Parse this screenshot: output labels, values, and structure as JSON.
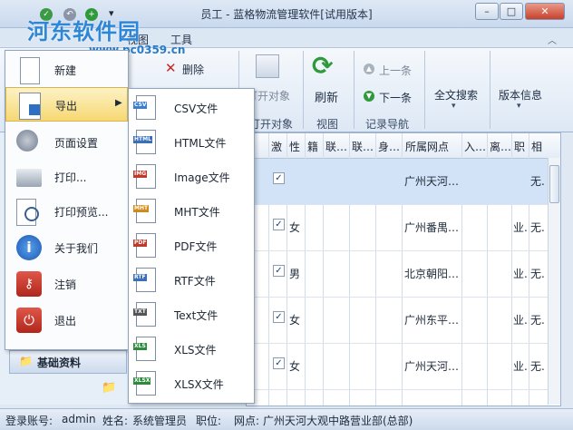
{
  "window": {
    "title": "员工 - 蓝格物流管理软件[试用版本]",
    "minimize": "–",
    "maximize": "□",
    "close": "✕"
  },
  "watermark": {
    "text": "河东软件园",
    "url": "www.pc0359.cn"
  },
  "ribbon": {
    "tabs": [
      "视图",
      "工具"
    ],
    "delete_label": "删除",
    "open_object_label": "打开对象",
    "open_object_group": "打开对象",
    "refresh_label": "刷新",
    "view_group": "视图",
    "prev_label": "上一条",
    "next_label": "下一条",
    "nav_group": "记录导航",
    "fulltext_label": "全文搜索",
    "version_label": "版本信息"
  },
  "grid": {
    "columns": [
      "激",
      "性",
      "籍",
      "联…",
      "联…",
      "身…",
      "所属网点",
      "入…",
      "离…",
      "职",
      "相"
    ],
    "rows": [
      {
        "active": true,
        "gender": "",
        "branch": "广州天河…",
        "job": "",
        "rel": "无."
      },
      {
        "active": true,
        "gender": "女",
        "branch": "广州番禺…",
        "job": "业.",
        "rel": "无."
      },
      {
        "active": true,
        "gender": "男",
        "branch": "北京朝阳…",
        "job": "业.",
        "rel": "无."
      },
      {
        "active": true,
        "gender": "女",
        "branch": "广州东平…",
        "job": "业.",
        "rel": "无."
      },
      {
        "active": true,
        "gender": "女",
        "branch": "广州天河…",
        "job": "业.",
        "rel": "无."
      }
    ]
  },
  "nav": {
    "header": "基础资料"
  },
  "app_menu": {
    "items": [
      {
        "label": "新建",
        "icon": "new-doc-icon"
      },
      {
        "label": "导出",
        "icon": "export-icon"
      },
      {
        "label": "页面设置",
        "icon": "page-setup-icon"
      },
      {
        "label": "打印...",
        "icon": "printer-icon"
      },
      {
        "label": "打印预览...",
        "icon": "print-preview-icon"
      },
      {
        "label": "关于我们",
        "icon": "info-icon"
      },
      {
        "label": "注销",
        "icon": "key-icon"
      },
      {
        "label": "退出",
        "icon": "power-icon"
      }
    ]
  },
  "export_menu": {
    "items": [
      {
        "label": "CSV文件",
        "tag": "CSV",
        "color": "#3b7fd0"
      },
      {
        "label": "HTML文件",
        "tag": "HTML",
        "color": "#3b6fb8"
      },
      {
        "label": "Image文件",
        "tag": "IMG",
        "color": "#c0392b"
      },
      {
        "label": "MHT文件",
        "tag": "MHT",
        "color": "#d08a1e"
      },
      {
        "label": "PDF文件",
        "tag": "PDF",
        "color": "#c0392b"
      },
      {
        "label": "RTF文件",
        "tag": "RTF",
        "color": "#3b6fb8"
      },
      {
        "label": "Text文件",
        "tag": "TXT",
        "color": "#555555"
      },
      {
        "label": "XLS文件",
        "tag": "XLS",
        "color": "#2e8b3e"
      },
      {
        "label": "XLSX文件",
        "tag": "XLSX",
        "color": "#2e8b3e"
      }
    ]
  },
  "status": {
    "account_label": "登录账号:",
    "account": "admin",
    "name_label": "姓名:",
    "name": "系统管理员",
    "position_label": "职位:",
    "branch_label": "网点:",
    "branch": "广州天河大观中路营业部(总部)"
  }
}
